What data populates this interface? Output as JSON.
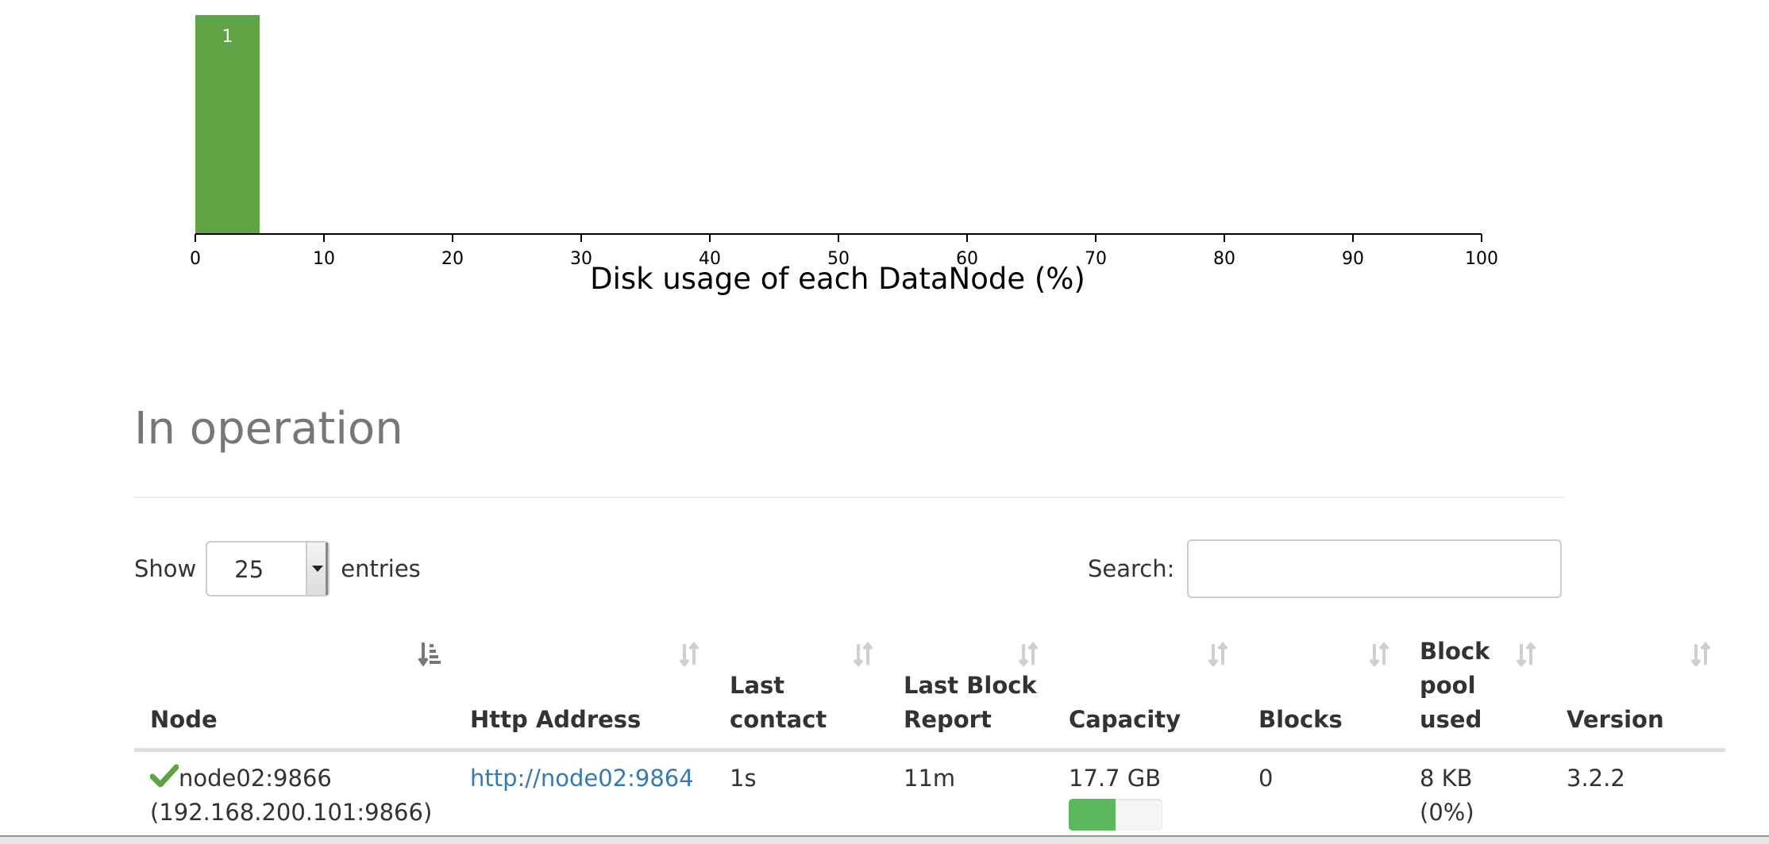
{
  "chart_data": {
    "type": "bar",
    "xlabel": "Disk usage of each DataNode (%)",
    "x_ticks": [
      0,
      10,
      20,
      30,
      40,
      50,
      60,
      70,
      80,
      90,
      100
    ],
    "xlim": [
      0,
      100
    ],
    "bins": [
      {
        "x0": 0,
        "x1": 5,
        "count": 1
      }
    ],
    "bar_color": "#5ea444"
  },
  "section": {
    "title": "In operation"
  },
  "controls": {
    "show_label": "Show",
    "entries_value": "25",
    "entries_label": "entries",
    "search_label": "Search:",
    "search_value": ""
  },
  "table": {
    "columns": [
      "Node",
      "Http Address",
      "Last contact",
      "Last Block Report",
      "Capacity",
      "Blocks",
      "Block pool used",
      "Version"
    ],
    "rows": [
      {
        "node_name": "node02:9866",
        "node_ip": "(192.168.200.101:9866)",
        "http_address": "http://node02:9864",
        "last_contact": "1s",
        "last_block_report": "11m",
        "capacity": "17.7 GB",
        "capacity_used_fraction": 0.5,
        "blocks": "0",
        "block_pool_used": "8 KB",
        "block_pool_pct": "(0%)",
        "version": "3.2.2",
        "status_icon": "check-icon"
      }
    ]
  },
  "colors": {
    "accent_green": "#5ea444",
    "link": "#337ab7",
    "muted_heading": "#777777"
  }
}
